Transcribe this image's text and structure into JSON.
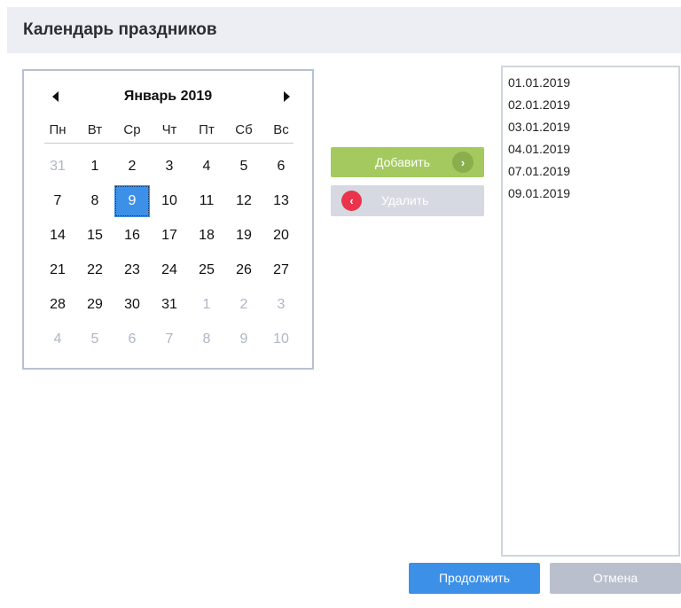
{
  "header": {
    "title": "Календарь праздников"
  },
  "calendar": {
    "month_title": "Январь 2019",
    "weekdays": [
      "Пн",
      "Вт",
      "Ср",
      "Чт",
      "Пт",
      "Сб",
      "Вс"
    ],
    "weeks": [
      [
        {
          "d": "31",
          "other": true
        },
        {
          "d": "1"
        },
        {
          "d": "2"
        },
        {
          "d": "3"
        },
        {
          "d": "4"
        },
        {
          "d": "5"
        },
        {
          "d": "6"
        }
      ],
      [
        {
          "d": "7"
        },
        {
          "d": "8"
        },
        {
          "d": "9",
          "selected": true
        },
        {
          "d": "10"
        },
        {
          "d": "11"
        },
        {
          "d": "12"
        },
        {
          "d": "13"
        }
      ],
      [
        {
          "d": "14"
        },
        {
          "d": "15"
        },
        {
          "d": "16"
        },
        {
          "d": "17"
        },
        {
          "d": "18"
        },
        {
          "d": "19"
        },
        {
          "d": "20"
        }
      ],
      [
        {
          "d": "21"
        },
        {
          "d": "22"
        },
        {
          "d": "23"
        },
        {
          "d": "24"
        },
        {
          "d": "25"
        },
        {
          "d": "26"
        },
        {
          "d": "27"
        }
      ],
      [
        {
          "d": "28"
        },
        {
          "d": "29"
        },
        {
          "d": "30"
        },
        {
          "d": "31"
        },
        {
          "d": "1",
          "other": true
        },
        {
          "d": "2",
          "other": true
        },
        {
          "d": "3",
          "other": true
        }
      ],
      [
        {
          "d": "4",
          "other": true
        },
        {
          "d": "5",
          "other": true
        },
        {
          "d": "6",
          "other": true
        },
        {
          "d": "7",
          "other": true
        },
        {
          "d": "8",
          "other": true
        },
        {
          "d": "9",
          "other": true
        },
        {
          "d": "10",
          "other": true
        }
      ]
    ],
    "selected_color": "#3d90e8"
  },
  "actions": {
    "add_label": "Добавить",
    "add_icon": "chevron-right-icon",
    "add_color": "#a4c95f",
    "remove_label": "Удалить",
    "remove_icon": "chevron-left-icon",
    "remove_color": "#e9344c"
  },
  "dates": [
    "01.01.2019",
    "02.01.2019",
    "03.01.2019",
    "04.01.2019",
    "07.01.2019",
    "09.01.2019"
  ],
  "footer": {
    "continue_label": "Продолжить",
    "cancel_label": "Отмена",
    "continue_color": "#3d90e8",
    "cancel_color": "#b9bfcc"
  }
}
